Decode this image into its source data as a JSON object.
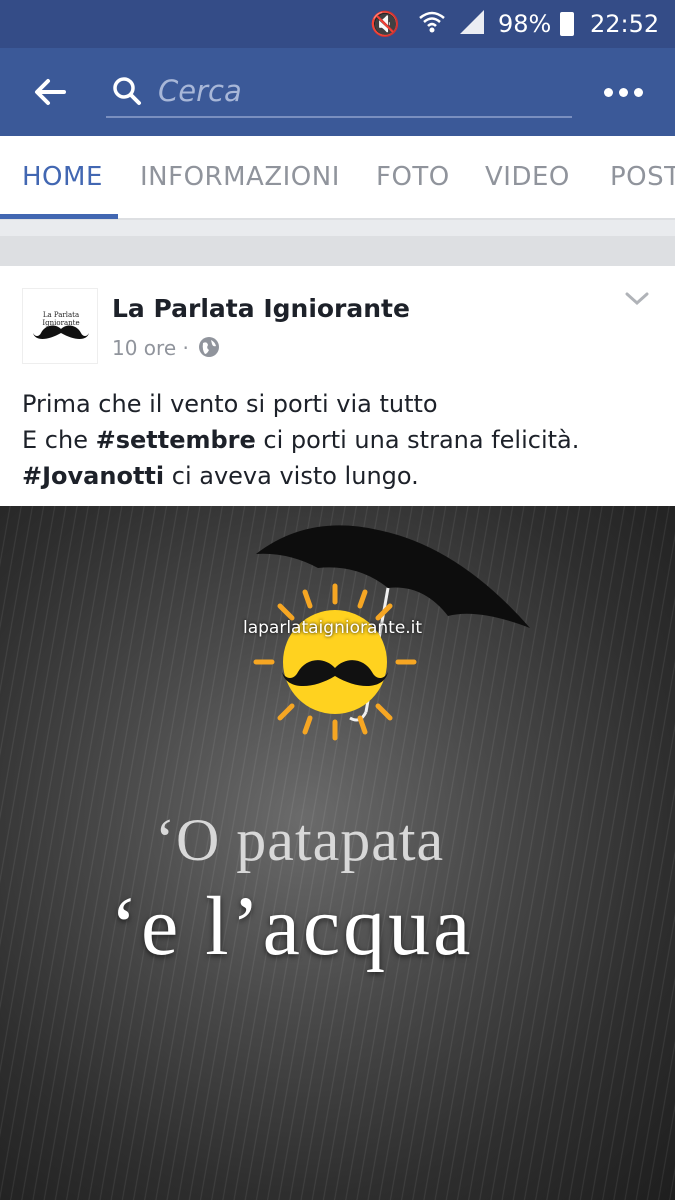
{
  "status_bar": {
    "battery": "98%",
    "time": "22:52",
    "icons": [
      "mute-icon",
      "wifi-icon",
      "signal-icon",
      "battery-icon"
    ]
  },
  "search": {
    "placeholder": "Cerca"
  },
  "tabs": [
    {
      "label": "HOME",
      "active": true
    },
    {
      "label": "INFORMAZIONI",
      "active": false
    },
    {
      "label": "FOTO",
      "active": false
    },
    {
      "label": "VIDEO",
      "active": false
    },
    {
      "label": "POST",
      "active": false
    }
  ],
  "post": {
    "page_name": "La Parlata Igniorante",
    "avatar_text": "La Parlata Igniorante",
    "time": "10 ore ·",
    "text": {
      "line1": "Prima che il vento si porti via tutto",
      "line2_pre": "E che ",
      "line2_tag": "#settembre",
      "line2_post": " ci porti una strana felicità.",
      "line3_tag": "#Jovanotti",
      "line3_post": " ci aveva visto lungo."
    },
    "image": {
      "site_url": "laparlataigniorante.it",
      "quote_line1": "‘O patapata",
      "quote_line2": "‘e l’acqua"
    }
  },
  "colors": {
    "status_bar": "#344c87",
    "header": "#3b5998",
    "active_tab": "#4267b2",
    "inactive_tab": "#90949c"
  }
}
